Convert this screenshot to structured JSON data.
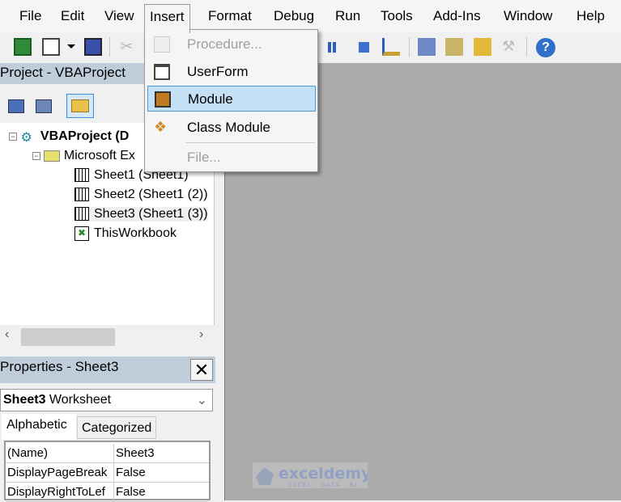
{
  "menubar": {
    "items": [
      {
        "label": "File"
      },
      {
        "label": "Edit"
      },
      {
        "label": "View"
      },
      {
        "label": "Insert"
      },
      {
        "label": "Format"
      },
      {
        "label": "Debug"
      },
      {
        "label": "Run"
      },
      {
        "label": "Tools"
      },
      {
        "label": "Add-Ins"
      },
      {
        "label": "Window"
      },
      {
        "label": "Help"
      }
    ]
  },
  "insert_menu": {
    "items": [
      {
        "label": "Procedure...",
        "enabled": false,
        "icon": "procedure-icon"
      },
      {
        "label": "UserForm",
        "enabled": true,
        "icon": "userform-icon"
      },
      {
        "label": "Module",
        "enabled": true,
        "highlighted": true,
        "icon": "module-icon"
      },
      {
        "label": "Class Module",
        "enabled": true,
        "icon": "class-module-icon"
      },
      {
        "label": "File...",
        "enabled": false
      }
    ]
  },
  "toolbar": {
    "icons": [
      "excel-icon",
      "insert-userform-icon",
      "dropdown-arrow-icon",
      "save-icon",
      "cut-icon",
      "break-icon",
      "reset-icon",
      "design-mode-icon",
      "project-explorer-icon",
      "properties-window-icon",
      "object-browser-icon",
      "toolbox-icon",
      "help-icon"
    ]
  },
  "project": {
    "title": "Project - VBAProject",
    "root": "VBAProject (D",
    "folder": "Microsoft Ex",
    "items": [
      "Sheet1 (Sheet1)",
      "Sheet2 (Sheet1 (2))",
      "Sheet3 (Sheet1 (3))",
      "ThisWorkbook"
    ]
  },
  "properties": {
    "title": "Properties - Sheet3",
    "object_name": "Sheet3",
    "object_type": "Worksheet",
    "tabs": [
      "Alphabetic",
      "Categorized"
    ],
    "rows": [
      {
        "name": "(Name)",
        "value": "Sheet3"
      },
      {
        "name": "DisplayPageBreak",
        "value": "False"
      },
      {
        "name": "DisplayRightToLef",
        "value": "False"
      }
    ]
  },
  "watermark": {
    "brand": "exceldemy",
    "tagline": "EXCEL · DATA · BI"
  },
  "colors": {
    "highlight": "#c5dff5",
    "panel_title": "#bfcddb",
    "workspace": "#ababab"
  }
}
